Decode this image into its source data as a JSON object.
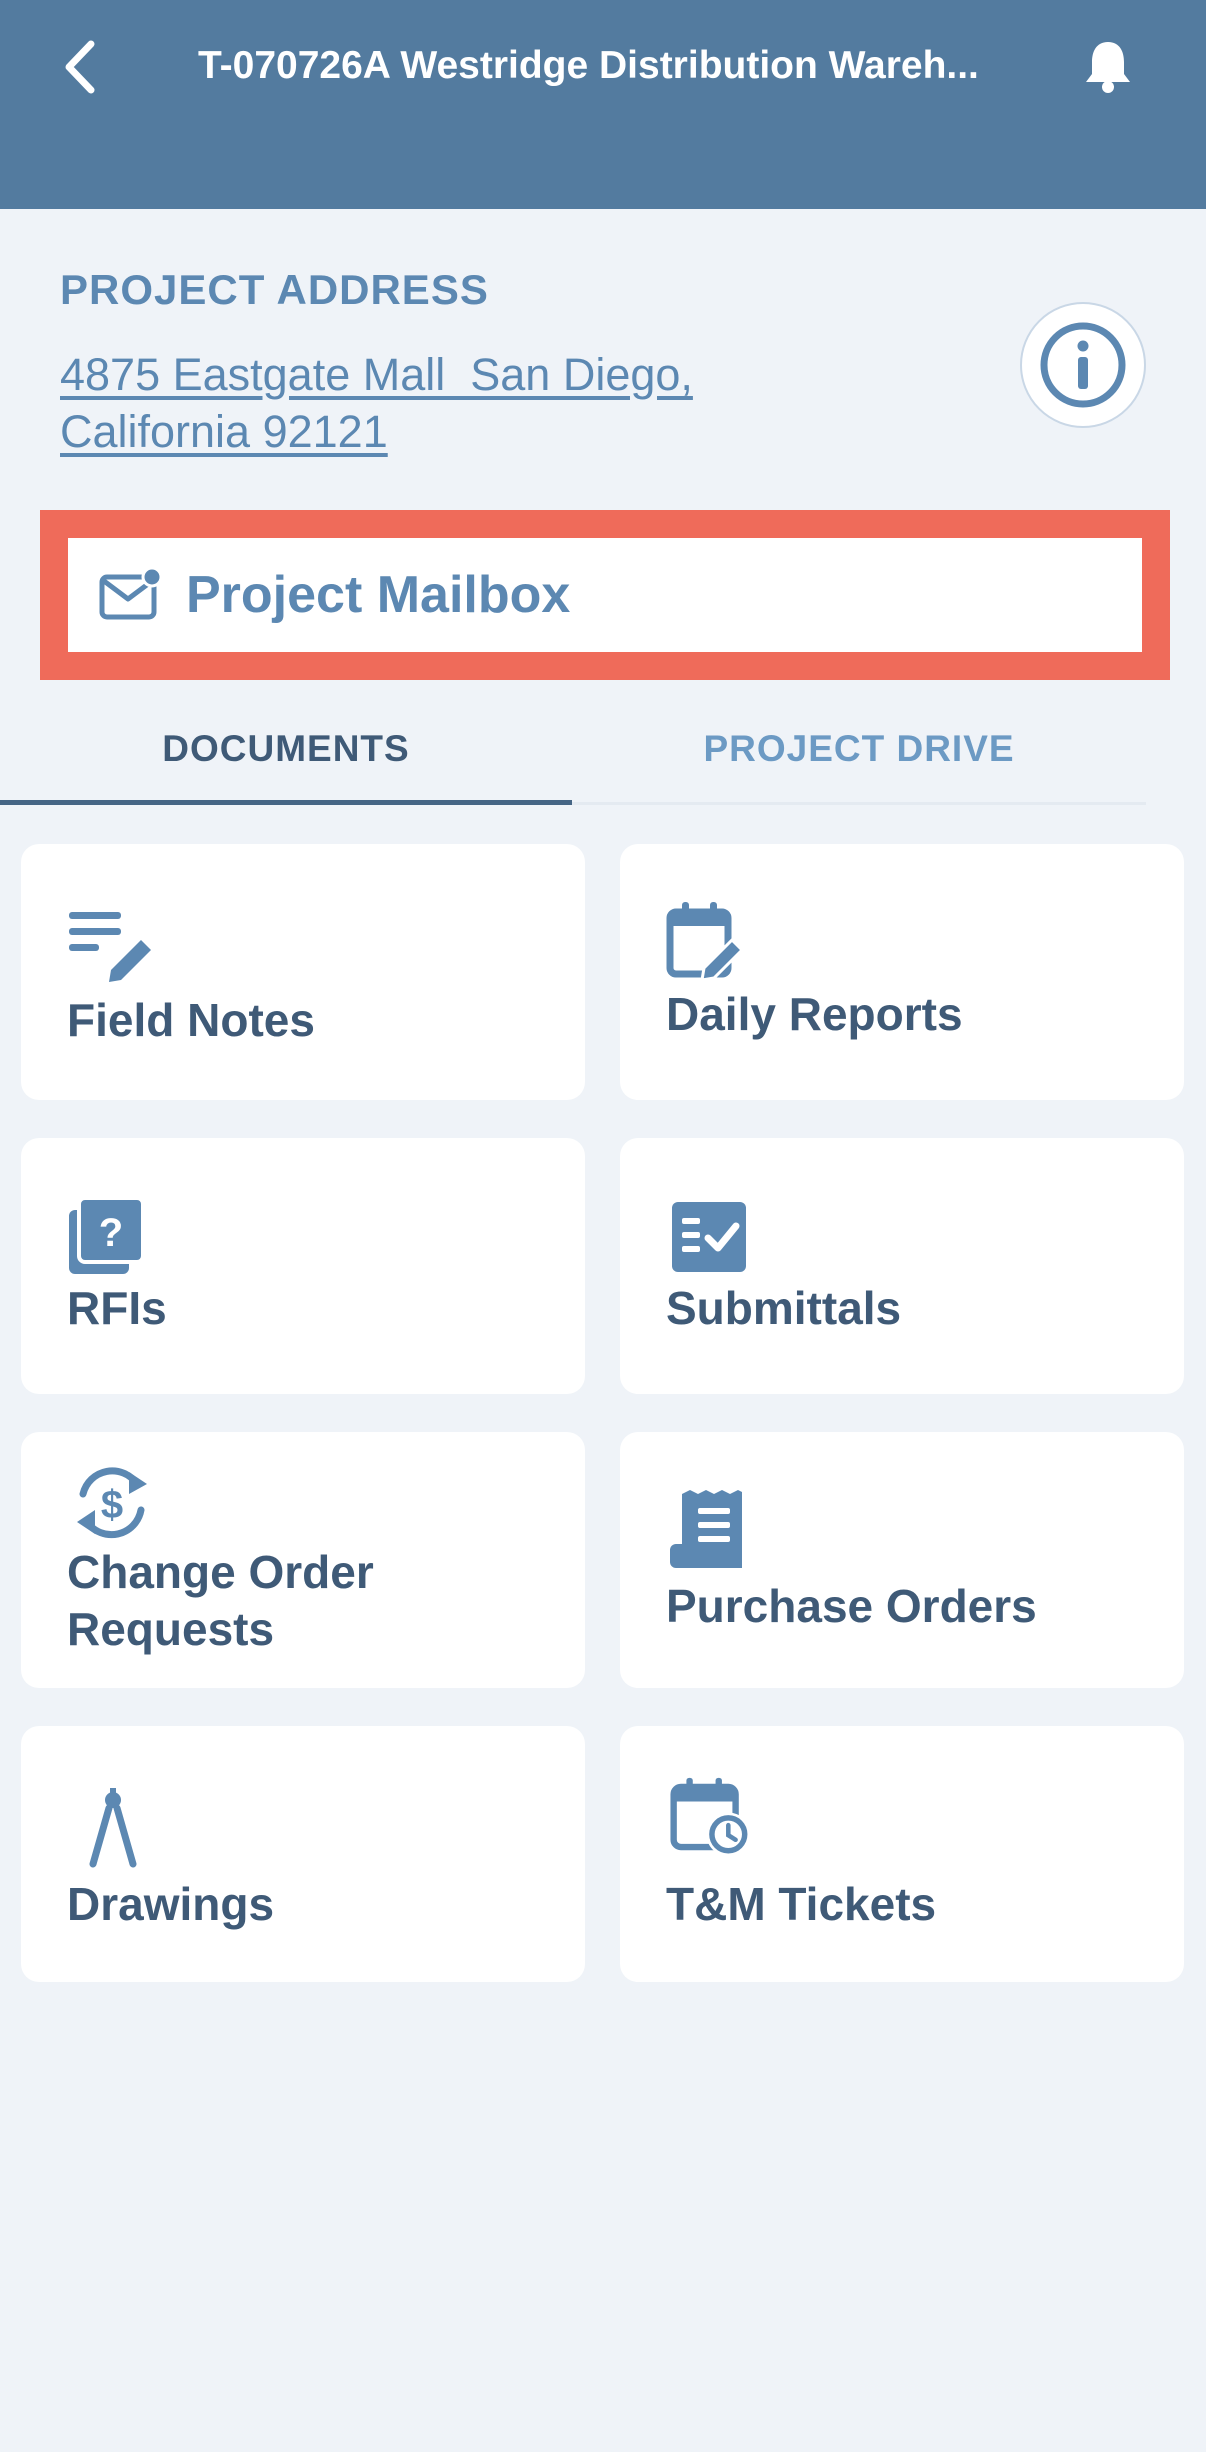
{
  "header": {
    "title": "T-070726A Westridge Distribution Wareh...",
    "back_icon": "chevron-left-icon",
    "bell_icon": "bell-icon",
    "background": "#537b9f"
  },
  "project": {
    "address_label": "PROJECT ADDRESS",
    "address_line1": "4875 Eastgate Mall  San Diego,",
    "address_line2": "California 92121",
    "info_icon": "info-icon"
  },
  "mailbox": {
    "label": "Project Mailbox",
    "icon": "mail-notification-icon",
    "highlight_color": "#ef6b5a"
  },
  "tabs": [
    {
      "label": "DOCUMENTS",
      "active": true
    },
    {
      "label": "PROJECT DRIVE",
      "active": false
    }
  ],
  "cards": [
    {
      "label": "Field Notes",
      "icon": "notes-edit-icon"
    },
    {
      "label": "Daily Reports",
      "icon": "calendar-edit-icon"
    },
    {
      "label": "RFIs",
      "icon": "question-pages-icon"
    },
    {
      "label": "Submittals",
      "icon": "checklist-icon"
    },
    {
      "label": "Change Order Requests",
      "icon": "dollar-cycle-icon"
    },
    {
      "label": "Purchase Orders",
      "icon": "receipt-icon"
    },
    {
      "label": "Drawings",
      "icon": "compass-icon"
    },
    {
      "label": "T&M Tickets",
      "icon": "calendar-clock-icon"
    }
  ],
  "colors": {
    "accent": "#5c88b2",
    "text_dark": "#3f5a77",
    "background": "#eff3f8"
  }
}
